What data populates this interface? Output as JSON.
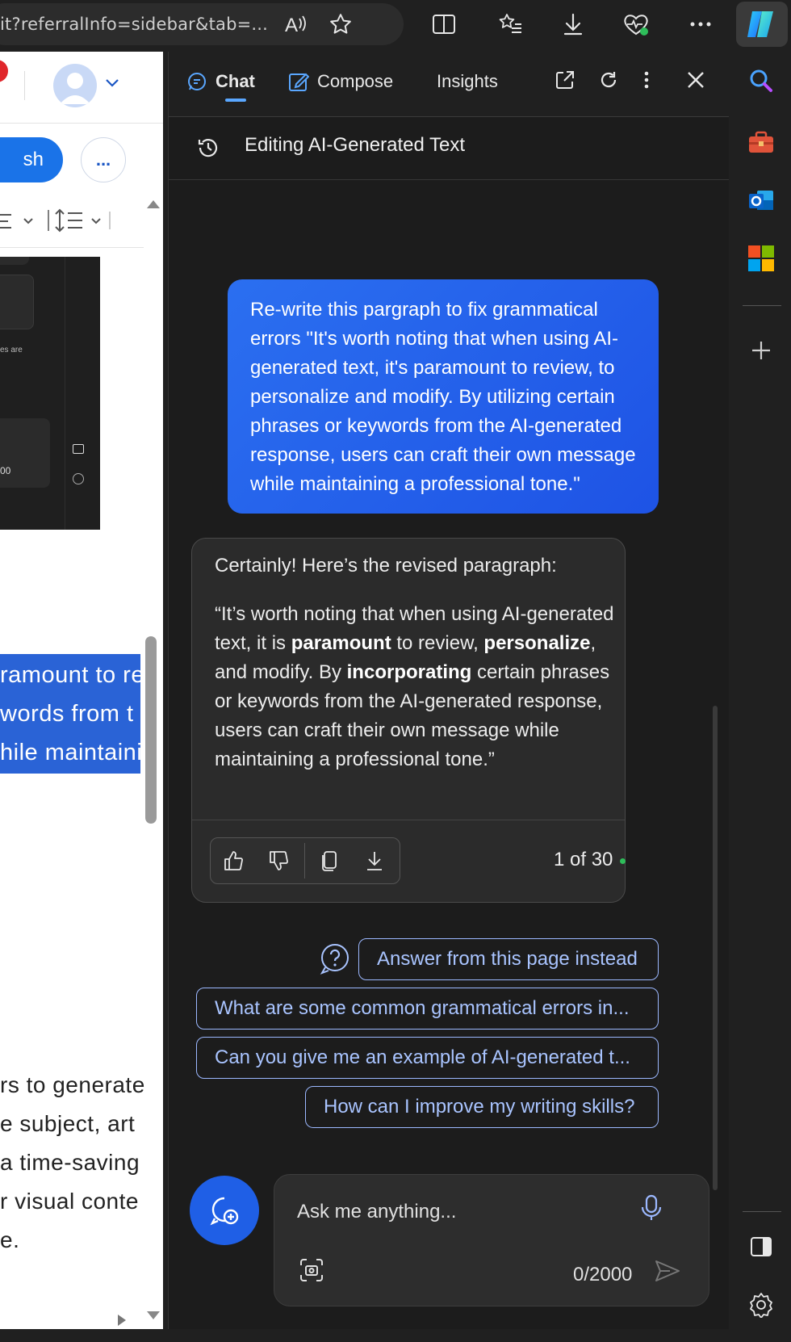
{
  "browser": {
    "url": "it?referralInfo=sidebar&tab=..."
  },
  "left_page": {
    "publish_label": "sh",
    "more_label": "...",
    "highlighted_lines": [
      "ramount to re",
      "words from t",
      "hile maintaini"
    ],
    "body_lines": [
      "rs to generate",
      "e subject, art",
      " a time-saving",
      "r visual conte",
      "e."
    ],
    "embedded_shot_text": [
      "es are",
      "00"
    ]
  },
  "sidebar": {
    "tabs": [
      {
        "label": "Chat"
      },
      {
        "label": "Compose"
      },
      {
        "label": "Insights"
      }
    ],
    "conversation_title": "Editing AI-Generated Text",
    "user_message": "Re-write this pargraph to fix grammatical errors \"It's worth noting that when using AI-generated text, it's paramount to review, to personalize and modify. By utilizing certain phrases or keywords from the AI-generated response, users can craft their own message while maintaining a professional tone.\"",
    "bot_intro": "Certainly! Here’s the revised paragraph:",
    "bot_parts": [
      "“It’s worth noting that when using AI-generated text, it is ",
      "paramount",
      " to review, ",
      "personalize",
      ", and modify. By ",
      "incorporating",
      " certain phrases or keywords from the AI-generated response, users can craft their own message while maintaining a professional tone.”"
    ],
    "response_counter": "1 of 30",
    "suggestions": [
      "Answer from this page instead",
      "What are some common grammatical errors in...",
      "Can you give me an example of AI-generated t...",
      "How can I improve my writing skills?"
    ],
    "input": {
      "placeholder": "Ask me anything...",
      "char_count": "0/2000"
    }
  },
  "colors": {
    "user_bubble": "#2b6ff0",
    "accent": "#5aa7ff",
    "suggestion_border": "#9cb8ff",
    "highlight": "#2a63d6"
  },
  "icons": [
    "read-aloud-icon",
    "favorite-star-icon",
    "split-screen-icon",
    "favorites-icon",
    "download-icon",
    "browser-essentials-icon",
    "more-icon",
    "copilot-icon",
    "search-icon",
    "tools-icon",
    "outlook-icon",
    "office-icon",
    "add-icon",
    "sidebar-toggle-icon",
    "settings-icon",
    "history-icon",
    "open-new-tab-icon",
    "refresh-icon",
    "close-icon",
    "thumbs-up-icon",
    "thumbs-down-icon",
    "copy-icon",
    "export-icon",
    "help-icon",
    "new-topic-icon",
    "microphone-icon",
    "image-capture-icon",
    "send-icon"
  ]
}
